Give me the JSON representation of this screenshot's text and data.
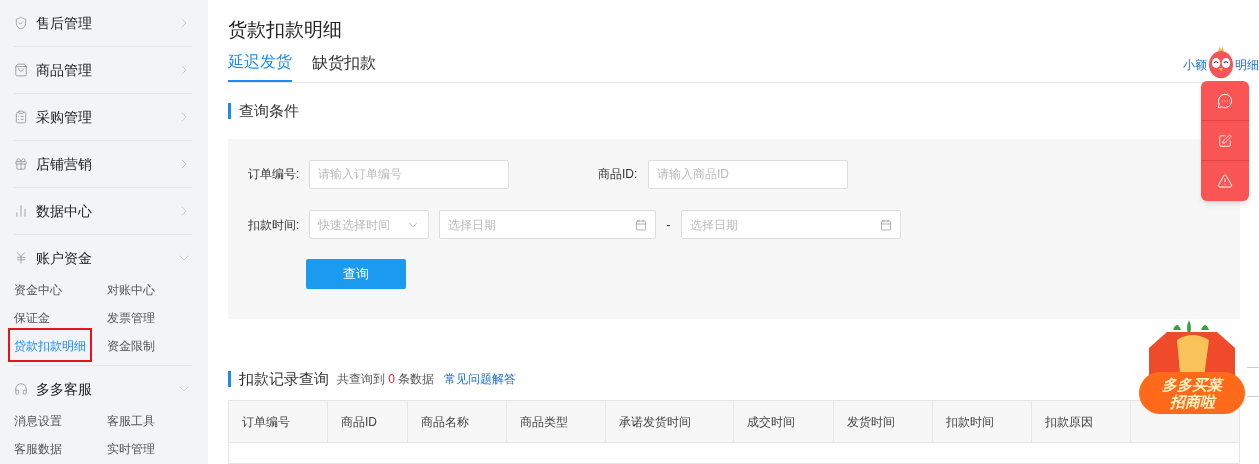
{
  "sidebar": {
    "items": [
      {
        "label": "售后管理",
        "expanded": false
      },
      {
        "label": "商品管理",
        "expanded": false
      },
      {
        "label": "采购管理",
        "expanded": false
      },
      {
        "label": "店铺营销",
        "expanded": false
      },
      {
        "label": "数据中心",
        "expanded": false
      },
      {
        "label": "账户资金",
        "expanded": true,
        "children": [
          {
            "label": "资金中心",
            "selected": false,
            "highlighted": false
          },
          {
            "label": "对账中心",
            "selected": false,
            "highlighted": false
          },
          {
            "label": "保证金",
            "selected": false,
            "highlighted": false
          },
          {
            "label": "发票管理",
            "selected": false,
            "highlighted": false
          },
          {
            "label": "贷款扣款明细",
            "selected": true,
            "highlighted": true
          },
          {
            "label": "资金限制",
            "selected": false,
            "highlighted": false
          }
        ]
      },
      {
        "label": "多多客服",
        "expanded": true,
        "children": [
          {
            "label": "消息设置",
            "selected": false,
            "highlighted": false
          },
          {
            "label": "客服工具",
            "selected": false,
            "highlighted": false
          },
          {
            "label": "客服数据",
            "selected": false,
            "highlighted": false
          },
          {
            "label": "实时管理",
            "selected": false,
            "highlighted": false
          }
        ]
      }
    ]
  },
  "page": {
    "title": "货款扣款明细",
    "tabs": [
      {
        "label": "延迟发货",
        "selected": true
      },
      {
        "label": "缺货扣款",
        "selected": false
      }
    ],
    "corner_link": [
      "小额",
      "明细"
    ]
  },
  "query": {
    "heading": "查询条件",
    "order_no": {
      "label": "订单编号:",
      "placeholder": "请输入订单编号"
    },
    "goods_id": {
      "label": "商品ID:",
      "placeholder": "请输入商品ID"
    },
    "deduct_time": {
      "label": "扣款时间:",
      "quick_placeholder": "快速选择时间",
      "start_placeholder": "选择日期",
      "separator": "-",
      "end_placeholder": "选择日期"
    },
    "button": "查询"
  },
  "records": {
    "heading": "扣款记录查询",
    "count_prefix": "共查询到",
    "count": "0",
    "count_suffix": "条数据",
    "faq_link": "常见问题解答",
    "columns": [
      "订单编号",
      "商品ID",
      "商品名称",
      "商品类型",
      "承诺发货时间",
      "成交时间",
      "发货时间",
      "扣款时间",
      "扣款原因"
    ]
  },
  "float_ad": {
    "lines": [
      "多多买菜",
      "招商啦"
    ]
  }
}
